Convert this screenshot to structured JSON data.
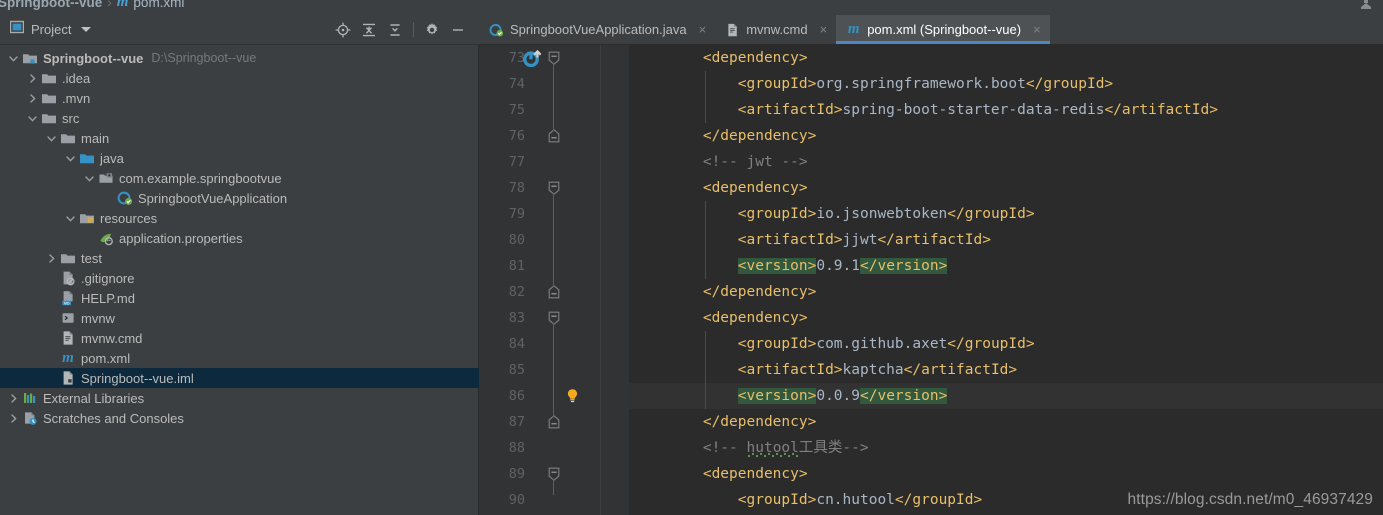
{
  "titlebar": {
    "breadcrumb_project": "Springboot--vue",
    "breadcrumb_separator": "›",
    "breadcrumb_file_icon": "m",
    "breadcrumb_file": "pom.xml",
    "window_icon": "maximize-icon"
  },
  "project_panel": {
    "title": "Project",
    "dropdown_icon": "chevron-down-icon",
    "tools": [
      {
        "name": "locate-file-icon",
        "label": "Select Opened File"
      },
      {
        "name": "collapse-all-icon",
        "label": "Collapse All"
      },
      {
        "name": "expand-all-icon",
        "label": "Expand All"
      },
      {
        "name": "settings-gear-icon",
        "label": "Settings"
      },
      {
        "name": "hide-panel-icon",
        "label": "Hide"
      }
    ],
    "tree": [
      {
        "label": "Springboot--vue",
        "path": "D:\\Springboot--vue",
        "icon": "module-folder-icon",
        "arrow": "expanded",
        "indent": 0,
        "bold": true,
        "selected": false
      },
      {
        "label": ".idea",
        "path": "",
        "icon": "folder-icon",
        "arrow": "collapsed",
        "indent": 1,
        "bold": false,
        "selected": false
      },
      {
        "label": ".mvn",
        "path": "",
        "icon": "folder-icon",
        "arrow": "collapsed",
        "indent": 1,
        "bold": false,
        "selected": false
      },
      {
        "label": "src",
        "path": "",
        "icon": "folder-icon",
        "arrow": "expanded",
        "indent": 1,
        "bold": false,
        "selected": false
      },
      {
        "label": "main",
        "path": "",
        "icon": "folder-icon",
        "arrow": "expanded",
        "indent": 2,
        "bold": false,
        "selected": false
      },
      {
        "label": "java",
        "path": "",
        "icon": "source-folder-icon",
        "arrow": "expanded",
        "indent": 3,
        "bold": false,
        "selected": false
      },
      {
        "label": "com.example.springbootvue",
        "path": "",
        "icon": "package-icon",
        "arrow": "expanded",
        "indent": 4,
        "bold": false,
        "selected": false
      },
      {
        "label": "SpringbootVueApplication",
        "path": "",
        "icon": "spring-class-icon",
        "arrow": "none",
        "indent": 5,
        "bold": false,
        "selected": false
      },
      {
        "label": "resources",
        "path": "",
        "icon": "resources-folder-icon",
        "arrow": "expanded",
        "indent": 3,
        "bold": false,
        "selected": false
      },
      {
        "label": "application.properties",
        "path": "",
        "icon": "spring-properties-icon",
        "arrow": "none",
        "indent": 4,
        "bold": false,
        "selected": false
      },
      {
        "label": "test",
        "path": "",
        "icon": "folder-icon",
        "arrow": "collapsed",
        "indent": 2,
        "bold": false,
        "selected": false
      },
      {
        "label": ".gitignore",
        "path": "",
        "icon": "gitignore-file-icon",
        "arrow": "none",
        "indent": 2,
        "bold": false,
        "selected": false
      },
      {
        "label": "HELP.md",
        "path": "",
        "icon": "markdown-file-icon",
        "arrow": "none",
        "indent": 2,
        "bold": false,
        "selected": false
      },
      {
        "label": "mvnw",
        "path": "",
        "icon": "shell-file-icon",
        "arrow": "none",
        "indent": 2,
        "bold": false,
        "selected": false
      },
      {
        "label": "mvnw.cmd",
        "path": "",
        "icon": "cmd-file-icon",
        "arrow": "none",
        "indent": 2,
        "bold": false,
        "selected": false
      },
      {
        "label": "pom.xml",
        "path": "",
        "icon": "maven-file-icon",
        "arrow": "none",
        "indent": 2,
        "bold": false,
        "selected": false
      },
      {
        "label": "Springboot--vue.iml",
        "path": "",
        "icon": "iml-file-icon",
        "arrow": "none",
        "indent": 2,
        "bold": false,
        "selected": true
      },
      {
        "label": "External Libraries",
        "path": "",
        "icon": "libraries-icon",
        "arrow": "collapsed",
        "indent": 0,
        "bold": false,
        "selected": false
      },
      {
        "label": "Scratches and Consoles",
        "path": "",
        "icon": "scratches-icon",
        "arrow": "collapsed",
        "indent": 0,
        "bold": false,
        "selected": false
      }
    ]
  },
  "editor": {
    "tabs": [
      {
        "label": "SpringbootVueApplication.java",
        "icon": "spring-class-icon",
        "active": false,
        "close_icon": "×"
      },
      {
        "label": "mvnw.cmd",
        "icon": "cmd-file-icon",
        "active": false,
        "close_icon": "×"
      },
      {
        "label": "pom.xml (Springboot--vue)",
        "icon": "maven-file-icon",
        "active": true,
        "close_icon": "×"
      }
    ],
    "caret_line": 86,
    "lines": [
      {
        "n": 73,
        "indent": 2,
        "gutter": "maven-reload-icon",
        "fold": "start",
        "bulb": false,
        "tokens": [
          {
            "t": "tag",
            "v": "<dependency>"
          }
        ]
      },
      {
        "n": 74,
        "indent": 3,
        "gutter": "",
        "fold": "",
        "bulb": false,
        "tokens": [
          {
            "t": "tag",
            "v": "<groupId>"
          },
          {
            "t": "val",
            "v": "org.springframework.boot"
          },
          {
            "t": "tag",
            "v": "</groupId>"
          }
        ]
      },
      {
        "n": 75,
        "indent": 3,
        "gutter": "",
        "fold": "",
        "bulb": false,
        "tokens": [
          {
            "t": "tag",
            "v": "<artifactId>"
          },
          {
            "t": "val",
            "v": "spring-boot-starter-data-redis"
          },
          {
            "t": "tag",
            "v": "</artifactId>"
          }
        ]
      },
      {
        "n": 76,
        "indent": 2,
        "gutter": "",
        "fold": "end",
        "bulb": false,
        "tokens": [
          {
            "t": "tag",
            "v": "</dependency>"
          }
        ]
      },
      {
        "n": 77,
        "indent": 2,
        "gutter": "",
        "fold": "",
        "bulb": false,
        "tokens": [
          {
            "t": "cmt",
            "v": "<!-- jwt -->"
          }
        ]
      },
      {
        "n": 78,
        "indent": 2,
        "gutter": "",
        "fold": "start",
        "bulb": false,
        "tokens": [
          {
            "t": "tag",
            "v": "<dependency>"
          }
        ]
      },
      {
        "n": 79,
        "indent": 3,
        "gutter": "",
        "fold": "",
        "bulb": false,
        "tokens": [
          {
            "t": "tag",
            "v": "<groupId>"
          },
          {
            "t": "val",
            "v": "io.jsonwebtoken"
          },
          {
            "t": "tag",
            "v": "</groupId>"
          }
        ]
      },
      {
        "n": 80,
        "indent": 3,
        "gutter": "",
        "fold": "",
        "bulb": false,
        "tokens": [
          {
            "t": "tag",
            "v": "<artifactId>"
          },
          {
            "t": "val",
            "v": "jjwt"
          },
          {
            "t": "tag",
            "v": "</artifactId>"
          }
        ]
      },
      {
        "n": 81,
        "indent": 3,
        "gutter": "",
        "fold": "",
        "bulb": false,
        "tokens": [
          {
            "t": "tag",
            "v": "<version>",
            "hl": true
          },
          {
            "t": "val",
            "v": "0.9.1"
          },
          {
            "t": "tag",
            "v": "</version>",
            "hl": true
          }
        ]
      },
      {
        "n": 82,
        "indent": 2,
        "gutter": "",
        "fold": "end",
        "bulb": false,
        "tokens": [
          {
            "t": "tag",
            "v": "</dependency>"
          }
        ]
      },
      {
        "n": 83,
        "indent": 2,
        "gutter": "",
        "fold": "start",
        "bulb": false,
        "tokens": [
          {
            "t": "tag",
            "v": "<dependency>"
          }
        ]
      },
      {
        "n": 84,
        "indent": 3,
        "gutter": "",
        "fold": "",
        "bulb": false,
        "tokens": [
          {
            "t": "tag",
            "v": "<groupId>"
          },
          {
            "t": "val",
            "v": "com.github.axet"
          },
          {
            "t": "tag",
            "v": "</groupId>"
          }
        ]
      },
      {
        "n": 85,
        "indent": 3,
        "gutter": "",
        "fold": "",
        "bulb": false,
        "tokens": [
          {
            "t": "tag",
            "v": "<artifactId>"
          },
          {
            "t": "val",
            "v": "kaptcha"
          },
          {
            "t": "tag",
            "v": "</artifactId>"
          }
        ]
      },
      {
        "n": 86,
        "indent": 3,
        "gutter": "",
        "fold": "",
        "bulb": true,
        "tokens": [
          {
            "t": "tag",
            "v": "<version>",
            "hl": true
          },
          {
            "t": "val",
            "v": "0.0.9"
          },
          {
            "t": "tag",
            "v": "</version>",
            "hl": true
          }
        ]
      },
      {
        "n": 87,
        "indent": 2,
        "gutter": "",
        "fold": "end",
        "bulb": false,
        "tokens": [
          {
            "t": "tag",
            "v": "</dependency>"
          }
        ]
      },
      {
        "n": 88,
        "indent": 2,
        "gutter": "",
        "fold": "",
        "bulb": false,
        "tokens": [
          {
            "t": "cmt",
            "v": "<!-- "
          },
          {
            "t": "cmt-squig",
            "v": "hutool"
          },
          {
            "t": "cmt",
            "v": "工具类-->"
          }
        ]
      },
      {
        "n": 89,
        "indent": 2,
        "gutter": "",
        "fold": "start",
        "bulb": false,
        "tokens": [
          {
            "t": "tag",
            "v": "<dependency>"
          }
        ]
      },
      {
        "n": 90,
        "indent": 3,
        "gutter": "",
        "fold": "",
        "bulb": false,
        "tokens": [
          {
            "t": "tag",
            "v": "<groupId>"
          },
          {
            "t": "val",
            "v": "cn.hutool"
          },
          {
            "t": "tag",
            "v": "</groupId>"
          }
        ]
      }
    ]
  },
  "watermark": "https://blog.csdn.net/m0_46937429",
  "colors": {
    "panel_bg": "#3c3f41",
    "editor_bg": "#2b2b2b",
    "gutter_bg": "#313335",
    "selection_bg": "#0d293e",
    "tab_active_bg": "#4e5254",
    "tab_underline": "#4a88c7",
    "tag": "#e8bf6a",
    "text": "#a9b7c6",
    "comment": "#808080",
    "highlight": "#32593d",
    "accent_blue": "#4b9fd5"
  }
}
